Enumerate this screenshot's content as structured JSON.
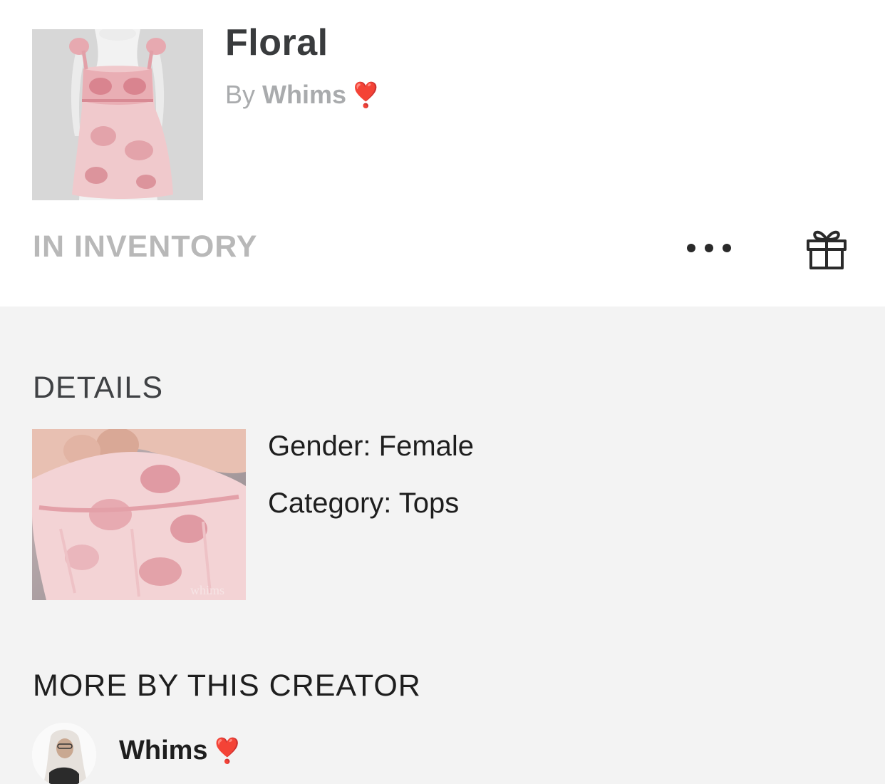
{
  "item": {
    "title": "Floral",
    "by_prefix": "By",
    "creator": "Whims",
    "creator_emoji": "❣️",
    "status": "IN INVENTORY"
  },
  "actions": {
    "more_icon": "ellipsis-icon",
    "gift_icon": "gift-icon"
  },
  "details": {
    "heading": "DETAILS",
    "gender": "Gender: Female",
    "category": "Category: Tops",
    "watermark": "whims"
  },
  "more_by_creator": {
    "heading": "MORE BY THIS CREATOR",
    "creator_name": "Whims",
    "creator_emoji": "❣️"
  },
  "colors": {
    "header_bg": "#ffffff",
    "body_bg": "#f3f3f3",
    "accent_pink": "#e8a0a8",
    "heart_red": "#d8192b"
  }
}
